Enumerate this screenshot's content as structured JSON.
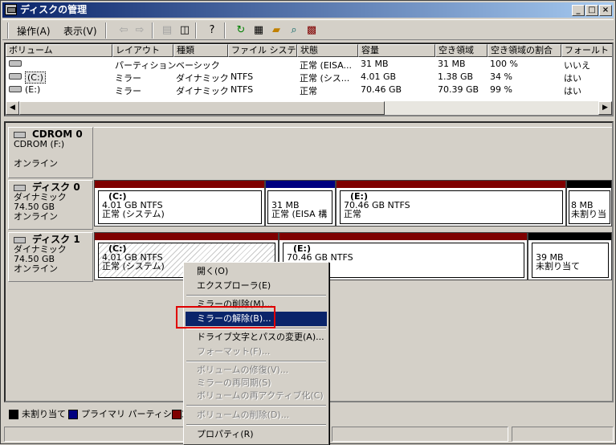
{
  "window": {
    "title": "ディスクの管理"
  },
  "menu": {
    "action": "操作(A)",
    "view": "表示(V)"
  },
  "columns": [
    "ボリューム",
    "レイアウト",
    "種類",
    "ファイル システム",
    "状態",
    "容量",
    "空き領域",
    "空き領域の割合",
    "フォールト トレ"
  ],
  "volumes": [
    {
      "volume": "",
      "layout": "パーティション",
      "type": "ベーシック",
      "fs": "",
      "status": "正常 (EISA...",
      "capacity": "31 MB",
      "free": "31 MB",
      "pct": "100 %",
      "fault": "いいえ"
    },
    {
      "volume": "(C:)",
      "layout": "ミラー",
      "type": "ダイナミック",
      "fs": "NTFS",
      "status": "正常 (シス...",
      "capacity": "4.01 GB",
      "free": "1.38 GB",
      "pct": "34 %",
      "fault": "はい"
    },
    {
      "volume": "(E:)",
      "layout": "ミラー",
      "type": "ダイナミック",
      "fs": "NTFS",
      "status": "正常",
      "capacity": "70.46 GB",
      "free": "70.39 GB",
      "pct": "99 %",
      "fault": "はい"
    }
  ],
  "disks": {
    "cdrom": {
      "title": "CDROM 0",
      "line1": "CDROM (F:)",
      "line2": "",
      "line3": "オンライン"
    },
    "disk0": {
      "title": "ディスク 0",
      "line1": "ダイナミック",
      "line2": "74.50 GB",
      "line3": "オンライン",
      "parts": [
        {
          "name": "(C:)",
          "size": "4.01 GB NTFS",
          "status": "正常 (システム)"
        },
        {
          "name": "",
          "size": "31 MB",
          "status": "正常 (EISA 構"
        },
        {
          "name": "(E:)",
          "size": "70.46 GB NTFS",
          "status": "正常"
        },
        {
          "name": "",
          "size": "8 MB",
          "status": "未割り当"
        }
      ]
    },
    "disk1": {
      "title": "ディスク 1",
      "line1": "ダイナミック",
      "line2": "74.50 GB",
      "line3": "オンライン",
      "parts": [
        {
          "name": "(C:)",
          "size": "4.01 GB NTFS",
          "status": "正常 (システム)"
        },
        {
          "name": "(E:)",
          "size": "70.46 GB NTFS",
          "status": ""
        },
        {
          "name": "",
          "size": "39 MB",
          "status": "未割り当て"
        }
      ]
    }
  },
  "legend": {
    "unallocated": "未割り当て",
    "primary": "プライマリ パーティション"
  },
  "context_menu": {
    "open": "開く(O)",
    "explore": "エクスプローラ(E)",
    "remove_mirror": "ミラーの削除(M)...",
    "break_mirror": "ミラーの解除(B)...",
    "change_letter": "ドライブ文字とパスの変更(A)...",
    "format": "フォーマット(F)...",
    "repair": "ボリュームの修復(V)...",
    "resync": "ミラーの再同期(S)",
    "reactivate": "ボリュームの再アクティブ化(C)",
    "delete": "ボリュームの削除(D)...",
    "properties": "プロパティ(R)"
  },
  "colors": {
    "mirror": "#7f0000",
    "primary": "#00007f",
    "unallocated": "#000000",
    "selection": "#0a246a"
  }
}
